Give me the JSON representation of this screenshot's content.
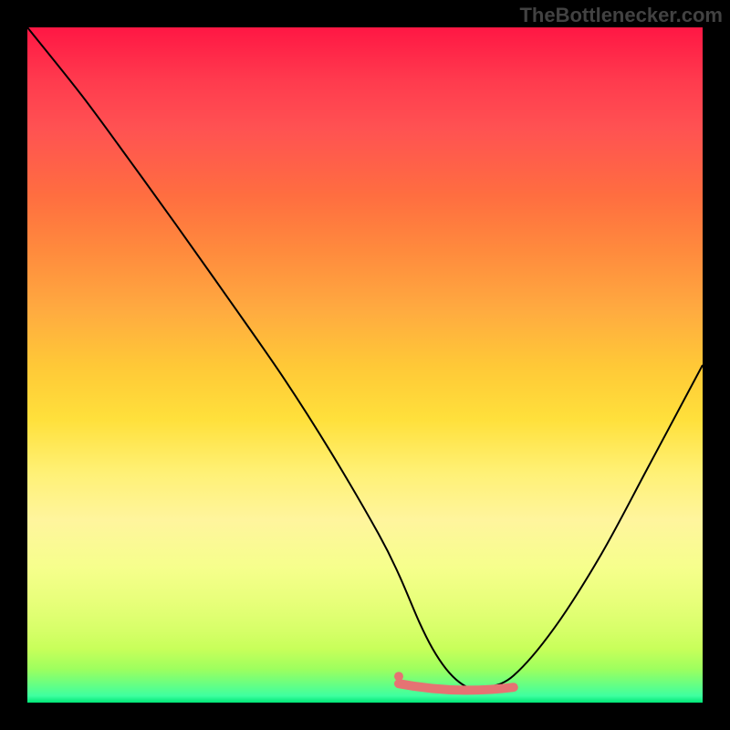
{
  "watermark": "TheBottlenecker.com",
  "chart_data": {
    "type": "line",
    "title": "",
    "xlabel": "",
    "ylabel": "",
    "xlim": [
      0,
      100
    ],
    "ylim": [
      0,
      100
    ],
    "series": [
      {
        "name": "bottleneck-curve",
        "x": [
          0,
          8,
          15,
          22,
          30,
          38,
          45,
          52,
          55,
          58,
          60,
          62,
          64,
          66,
          68,
          72,
          78,
          85,
          92,
          100
        ],
        "y": [
          100,
          90,
          80.5,
          70.8,
          59.5,
          48,
          37,
          25,
          19,
          12,
          8,
          5,
          3,
          2,
          2.2,
          4,
          11,
          22,
          35,
          50
        ]
      }
    ],
    "sweet_spot": {
      "x_range": [
        55,
        72
      ],
      "y_level": 2
    },
    "background_gradient": {
      "type": "vertical",
      "stops": [
        {
          "pos": 0,
          "color": "#ff1744"
        },
        {
          "pos": 50,
          "color": "#ffe03b"
        },
        {
          "pos": 100,
          "color": "#00e676"
        }
      ]
    }
  }
}
